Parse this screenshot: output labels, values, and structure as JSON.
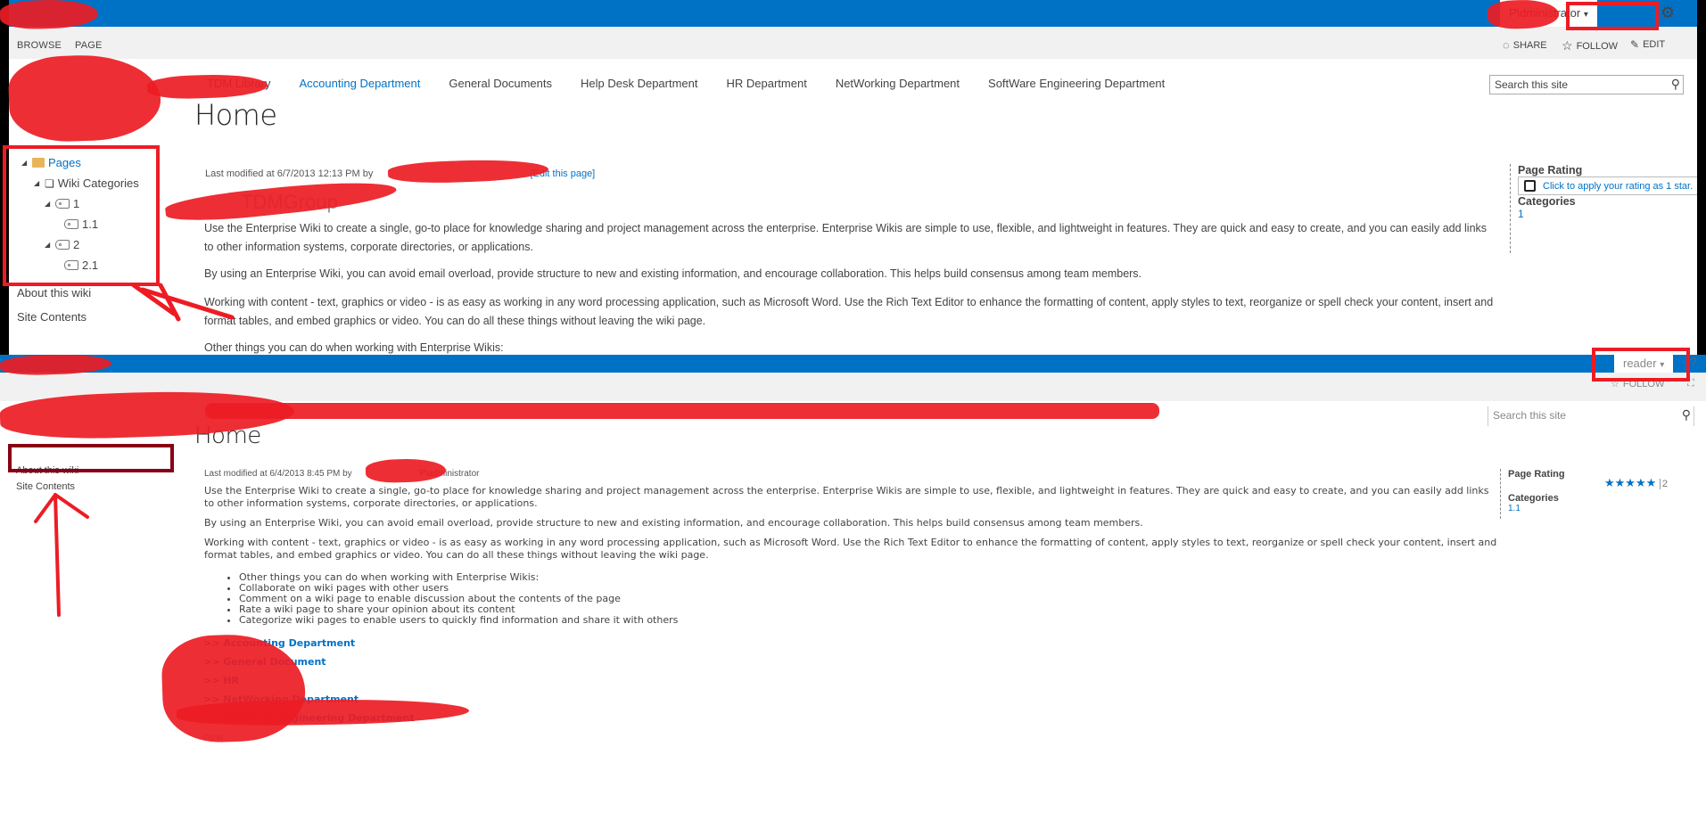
{
  "panels": {
    "top": {
      "suite_bar": {
        "user_label": "P\\dministrator",
        "user_caret": "▾",
        "settings_icon": "gear-icon"
      },
      "ribbon": {
        "tabs": [
          "BROWSE",
          "PAGE"
        ],
        "actions": [
          {
            "label": "SHARE",
            "icon": "share-icon"
          },
          {
            "label": "FOLLOW",
            "icon": "star-icon"
          },
          {
            "label": "EDIT",
            "icon": "pencil-icon"
          }
        ],
        "focus_icon": "focus-mode-icon"
      },
      "top_nav": {
        "items": [
          {
            "label": "TDM Library",
            "active": false
          },
          {
            "label": "Accounting Department",
            "active": true
          },
          {
            "label": "General Documents",
            "active": false
          },
          {
            "label": "Help Desk Department",
            "active": false
          },
          {
            "label": "HR Department",
            "active": false
          },
          {
            "label": "NetWorking Department",
            "active": false
          },
          {
            "label": "SoftWare Engineering Department",
            "active": false
          }
        ]
      },
      "search": {
        "placeholder": "Search this site"
      },
      "page_title": "Home",
      "tree": {
        "root": "Pages",
        "wiki_categories": "Wiki Categories",
        "nodes": [
          {
            "label": "1",
            "children": [
              "1.1"
            ]
          },
          {
            "label": "2",
            "children": [
              "2.1"
            ]
          }
        ]
      },
      "quick_launch": [
        "About this wiki",
        "Site Contents"
      ],
      "meta": {
        "modified": "Last modified at 6/7/2013 12:13 PM by",
        "edit_link": "[Edit this page]"
      },
      "subtitle": "TDMGroup",
      "paragraphs": [
        "Use the Enterprise Wiki to create a single, go-to place for knowledge sharing and project management across the enterprise. Enterprise Wikis are simple to use, flexible, and lightweight in features. They are quick and easy to create, and you can easily add links to other information systems, corporate directories, or applications.",
        "By using an Enterprise Wiki, you can avoid email overload, provide structure to new and existing information, and encourage collaboration. This helps build consensus among team members.",
        "Working with content - text, graphics or video - is as easy as working in any word processing application, such as Microsoft Word. Use the Rich Text Editor to enhance the formatting of content, apply styles to text, reorganize or spell check your content, insert and format tables, and embed graphics or video. You can do all these things without leaving the wiki page.",
        "Other things you can do when working with Enterprise Wikis:"
      ],
      "right": {
        "rating_heading": "Page Rating",
        "rating_prompt": "Click to apply your rating as 1 star.",
        "categories_heading": "Categories",
        "category": "1"
      }
    },
    "bottom": {
      "suite_bar": {
        "user_label": "reader",
        "user_caret": "▾",
        "help_icon": "help-icon"
      },
      "ribbon": {
        "actions": [
          {
            "label": "FOLLOW",
            "icon": "star-icon"
          }
        ],
        "focus_icon": "focus-mode-icon"
      },
      "search": {
        "placeholder": "Search this site"
      },
      "page_title": "Home",
      "quick_launch": [
        "About this wiki",
        "Site Contents"
      ],
      "meta": {
        "modified": "Last modified at 6/4/2013 8:45 PM by",
        "user_suffix": "P\\administrator"
      },
      "paragraphs": [
        "Use the Enterprise Wiki to create a single, go-to place for knowledge sharing and project management across the enterprise. Enterprise Wikis are simple to use, flexible, and lightweight in features. They are quick and easy to create, and you can easily add links to other information systems, corporate directories, or applications.",
        "By using an Enterprise Wiki, you can avoid email overload, provide structure to new and existing information, and encourage collaboration. This helps build consensus among team members.",
        "Working with content - text, graphics or video - is as easy as working in any word processing application, such as Microsoft Word. Use the Rich Text Editor to enhance the formatting of content, apply styles to text, reorganize or spell check your content, insert and format tables, and embed graphics or video. You can do all these things without leaving the wiki page."
      ],
      "bullets": [
        "Other things you can do when working with Enterprise Wikis:",
        "Collaborate on wiki pages with other users",
        "Comment on a wiki page to enable discussion about the contents of the page",
        "Rate a wiki page to share your opinion about its content",
        "Categorize wiki pages to enable users to quickly find information and share it with others"
      ],
      "dept_links": [
        ">> Accounting Department",
        ">> General Document",
        ">> HR",
        ">> NetWorking Department",
        ">> SoftWare Engineering Department",
        "new"
      ],
      "right": {
        "rating_heading": "Page Rating",
        "stars": "★★★★★",
        "rating_value": 5,
        "rating_count": "2",
        "categories_heading": "Categories",
        "category": "1.1"
      }
    }
  },
  "annotation_color": "#ed1c24",
  "accent_color": "#0072c6"
}
